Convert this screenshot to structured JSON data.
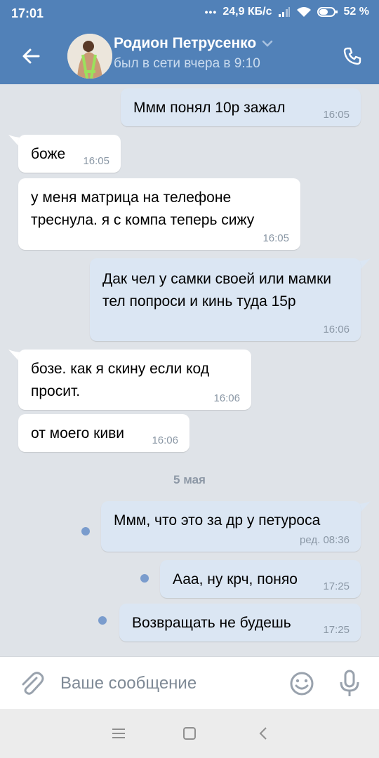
{
  "status_bar": {
    "time": "17:01",
    "network_speed": "24,9 КБ/с",
    "battery": "52 %"
  },
  "header": {
    "contact_name": "Родион Петрусенко",
    "last_seen": "был в сети вчера в 9:10",
    "icons": [
      "back-arrow-icon",
      "avatar",
      "chevron-down-icon",
      "phone-icon"
    ]
  },
  "messages": [
    {
      "direction": "out",
      "text": "Ммм понял 10р зажал",
      "time": "16:05"
    },
    {
      "direction": "in",
      "text": "боже",
      "time": "16:05"
    },
    {
      "direction": "in",
      "text": "у меня матрица на телефоне треснула. я с компа теперь сижу",
      "time": "16:05"
    },
    {
      "direction": "out",
      "text": "Дак чел у самки своей или мамки тел попроси и кинь туда 15р",
      "time": "16:06"
    },
    {
      "direction": "in",
      "text": "бозе. как я скину если код просит.",
      "time": "16:06"
    },
    {
      "direction": "in",
      "text": "от моего киви",
      "time": "16:06"
    },
    {
      "direction": "out",
      "text": "Ммм, что это за др у петуроса",
      "time": "ред. 08:36",
      "unread": true
    },
    {
      "direction": "out",
      "text": "Ааа, ну крч, поняо",
      "time": "17:25",
      "unread": true
    },
    {
      "direction": "out",
      "text": "Возвращать не будешь",
      "time": "17:25",
      "unread": true
    }
  ],
  "date_separator": "5 мая",
  "composer": {
    "placeholder": "Ваше сообщение",
    "value": ""
  },
  "colors": {
    "header": "#5181b8",
    "background": "#dfe3e8",
    "incoming_bubble": "#ffffff",
    "outgoing_bubble": "#dbe6f3",
    "unread_dot": "#7a9ccd",
    "icon_gray": "#99a2ad"
  }
}
